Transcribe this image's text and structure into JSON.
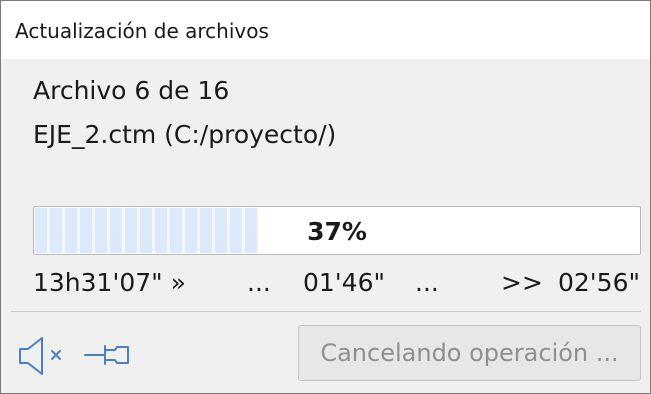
{
  "window": {
    "title": "Actualización de archivos"
  },
  "status": {
    "file_counter": "Archivo 6 de 16",
    "file_path": "EJE_2.ctm (C:/proyecto/)"
  },
  "progress": {
    "percent": 37,
    "label": "37%"
  },
  "timing": {
    "start_time": "13h31'07\" »",
    "dots_left": "...",
    "elapsed": "01'46\"",
    "dots_right": "...",
    "remaining_marker": ">>",
    "remaining": "02'56\""
  },
  "footer": {
    "mute_icon": "speaker-muted-icon",
    "pin_icon": "pin-icon",
    "cancel_label": "Cancelando operación ..."
  },
  "colors": {
    "progress_fill": "#dbe9fb",
    "disabled_text": "#8f8f8f",
    "icon_blue": "#4a7fc1"
  }
}
